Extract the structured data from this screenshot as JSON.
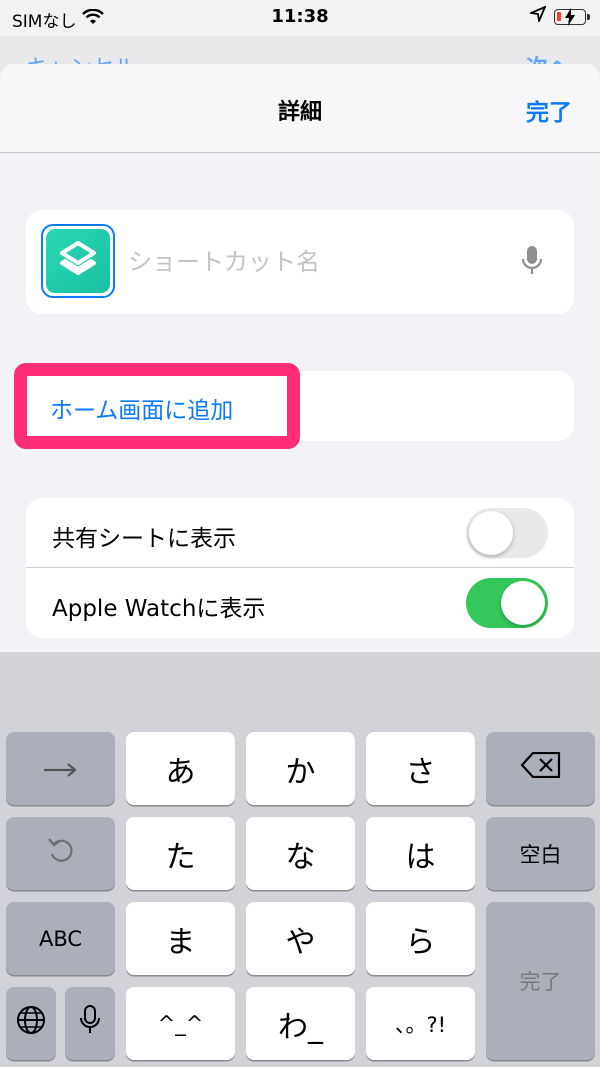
{
  "status_bar": {
    "carrier": "SIMなし",
    "time": "11:38"
  },
  "underlay": {
    "left_label": "キャンセル",
    "right_label": "次へ"
  },
  "nav": {
    "title": "詳細",
    "done": "完了"
  },
  "shortcut": {
    "name_placeholder": "ショートカット名",
    "icon_color": "#1fcfac"
  },
  "add_to_home": "ホーム画面に追加",
  "toggles": [
    {
      "label": "共有シートに表示",
      "on": false
    },
    {
      "label": "Apple Watchに表示",
      "on": true
    }
  ],
  "keyboard": {
    "row1": [
      "→",
      "あ",
      "か",
      "さ",
      "⌫"
    ],
    "row2": [
      "↺",
      "た",
      "な",
      "は",
      "空白"
    ],
    "row3": [
      "ABC",
      "ま",
      "や",
      "ら",
      "完了"
    ],
    "row4": [
      "🌐",
      "🎤",
      "^_^",
      "わ_",
      "、。?!"
    ]
  },
  "colors": {
    "accent": "#0a7aff",
    "highlight": "#ff2d78",
    "toggle_on": "#34c759"
  }
}
